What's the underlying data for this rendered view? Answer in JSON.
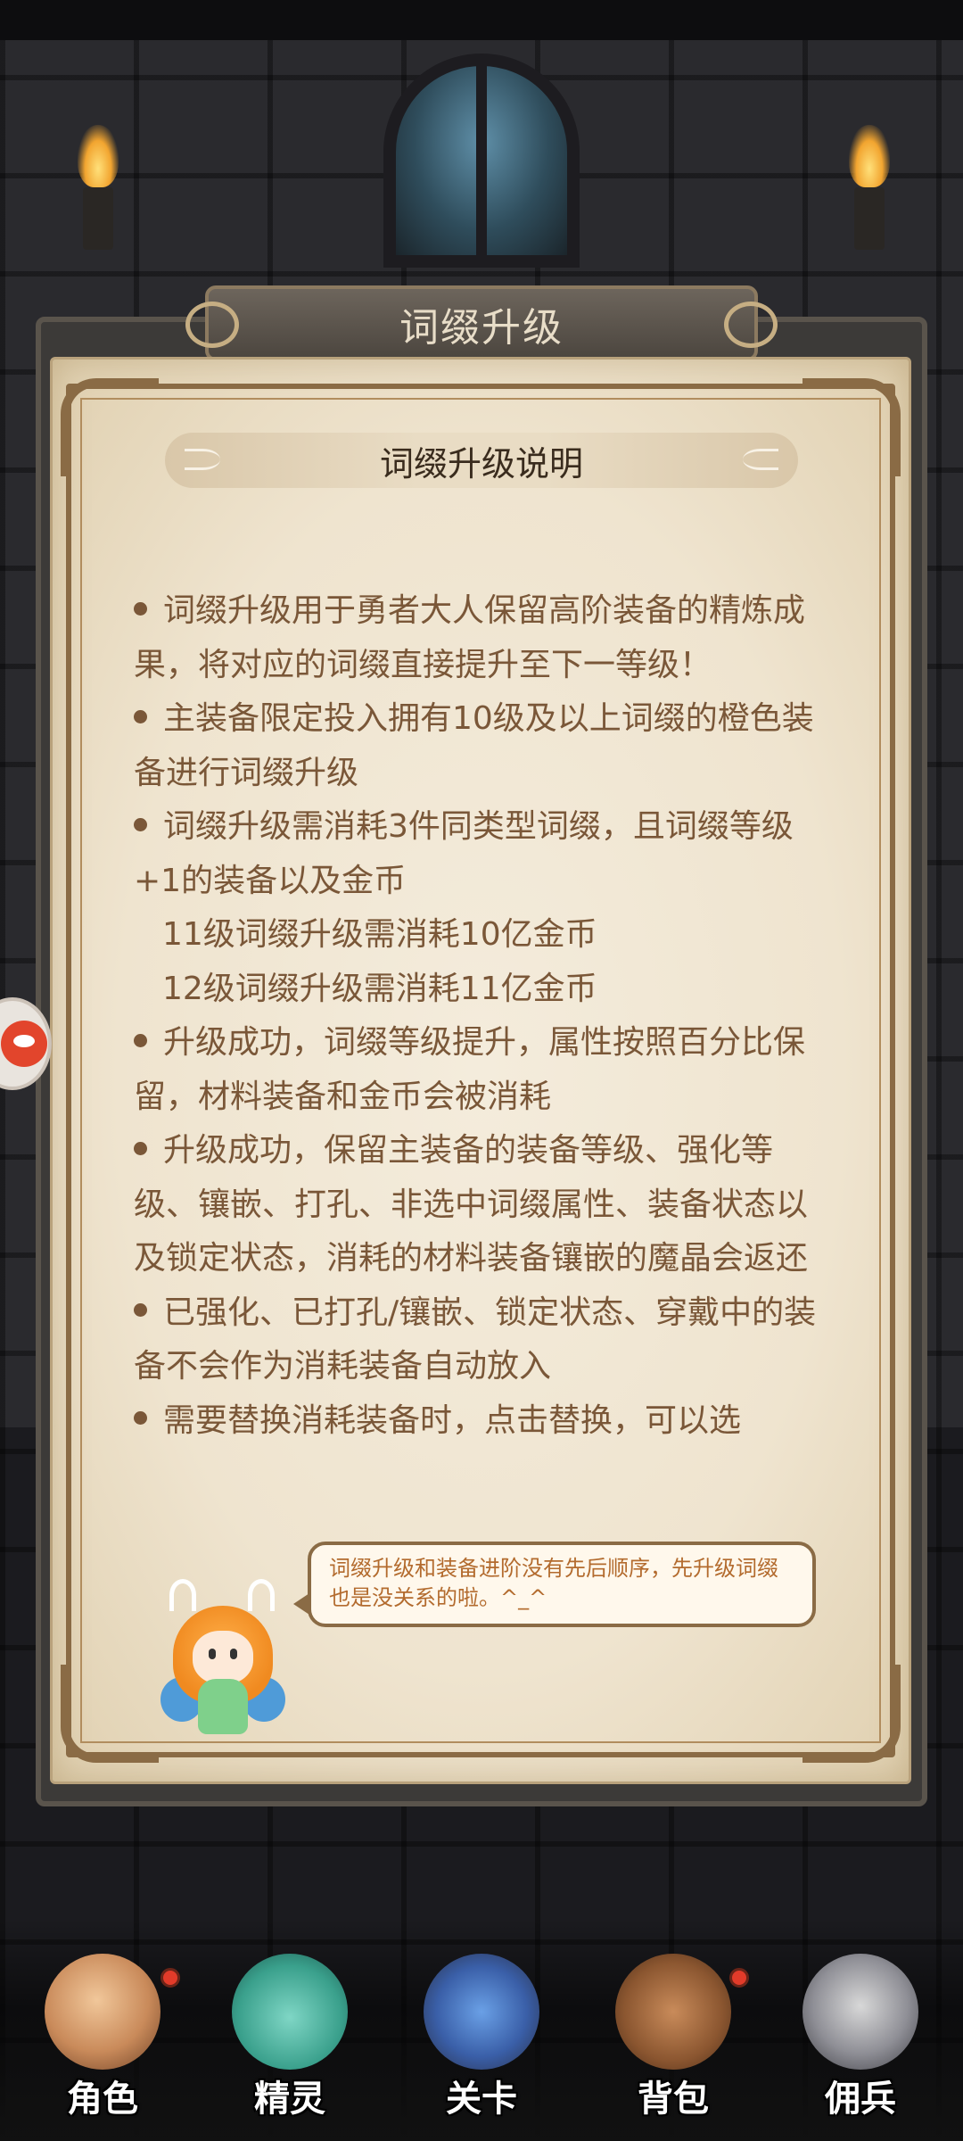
{
  "dialog": {
    "title": "词缀升级",
    "subtitle": "词缀升级说明"
  },
  "description": {
    "paragraphs": [
      "词缀升级用于勇者大人保留高阶装备的精炼成果，将对应的词缀直接提升至下一等级！",
      "主装备限定投入拥有10级及以上词缀的橙色装备进行词缀升级",
      "词缀升级需消耗3件同类型词缀，且词缀等级+1的装备以及金币"
    ],
    "costs": [
      "11级词缀升级需消耗10亿金币",
      "12级词缀升级需消耗11亿金币"
    ],
    "paragraphs2": [
      "升级成功，词缀等级提升，属性按照百分比保留，材料装备和金币会被消耗",
      "升级成功，保留主装备的装备等级、强化等级、镶嵌、打孔、非选中词缀属性、装备状态以及锁定状态，消耗的材料装备镶嵌的魔晶会返还",
      "已强化、已打孔/镶嵌、锁定状态、穿戴中的装备不会作为消耗装备自动放入",
      "需要替换消耗装备时，点击替换，可以选"
    ]
  },
  "helper": {
    "bubble_text": "词缀升级和装备进阶没有先后顺序，先升级词缀也是没关系的啦。^_^"
  },
  "nav": {
    "items": [
      {
        "label": "角色",
        "icon": "hero-icon"
      },
      {
        "label": "精灵",
        "icon": "sprite-icon"
      },
      {
        "label": "关卡",
        "icon": "stage-icon"
      },
      {
        "label": "背包",
        "icon": "bag-icon"
      },
      {
        "label": "佣兵",
        "icon": "mercenary-icon"
      }
    ]
  },
  "colors": {
    "parchment": "#efe4cf",
    "text_brown": "#7a5738",
    "bubble_text": "#b36b2e",
    "frame_brown": "#8a6b45"
  }
}
